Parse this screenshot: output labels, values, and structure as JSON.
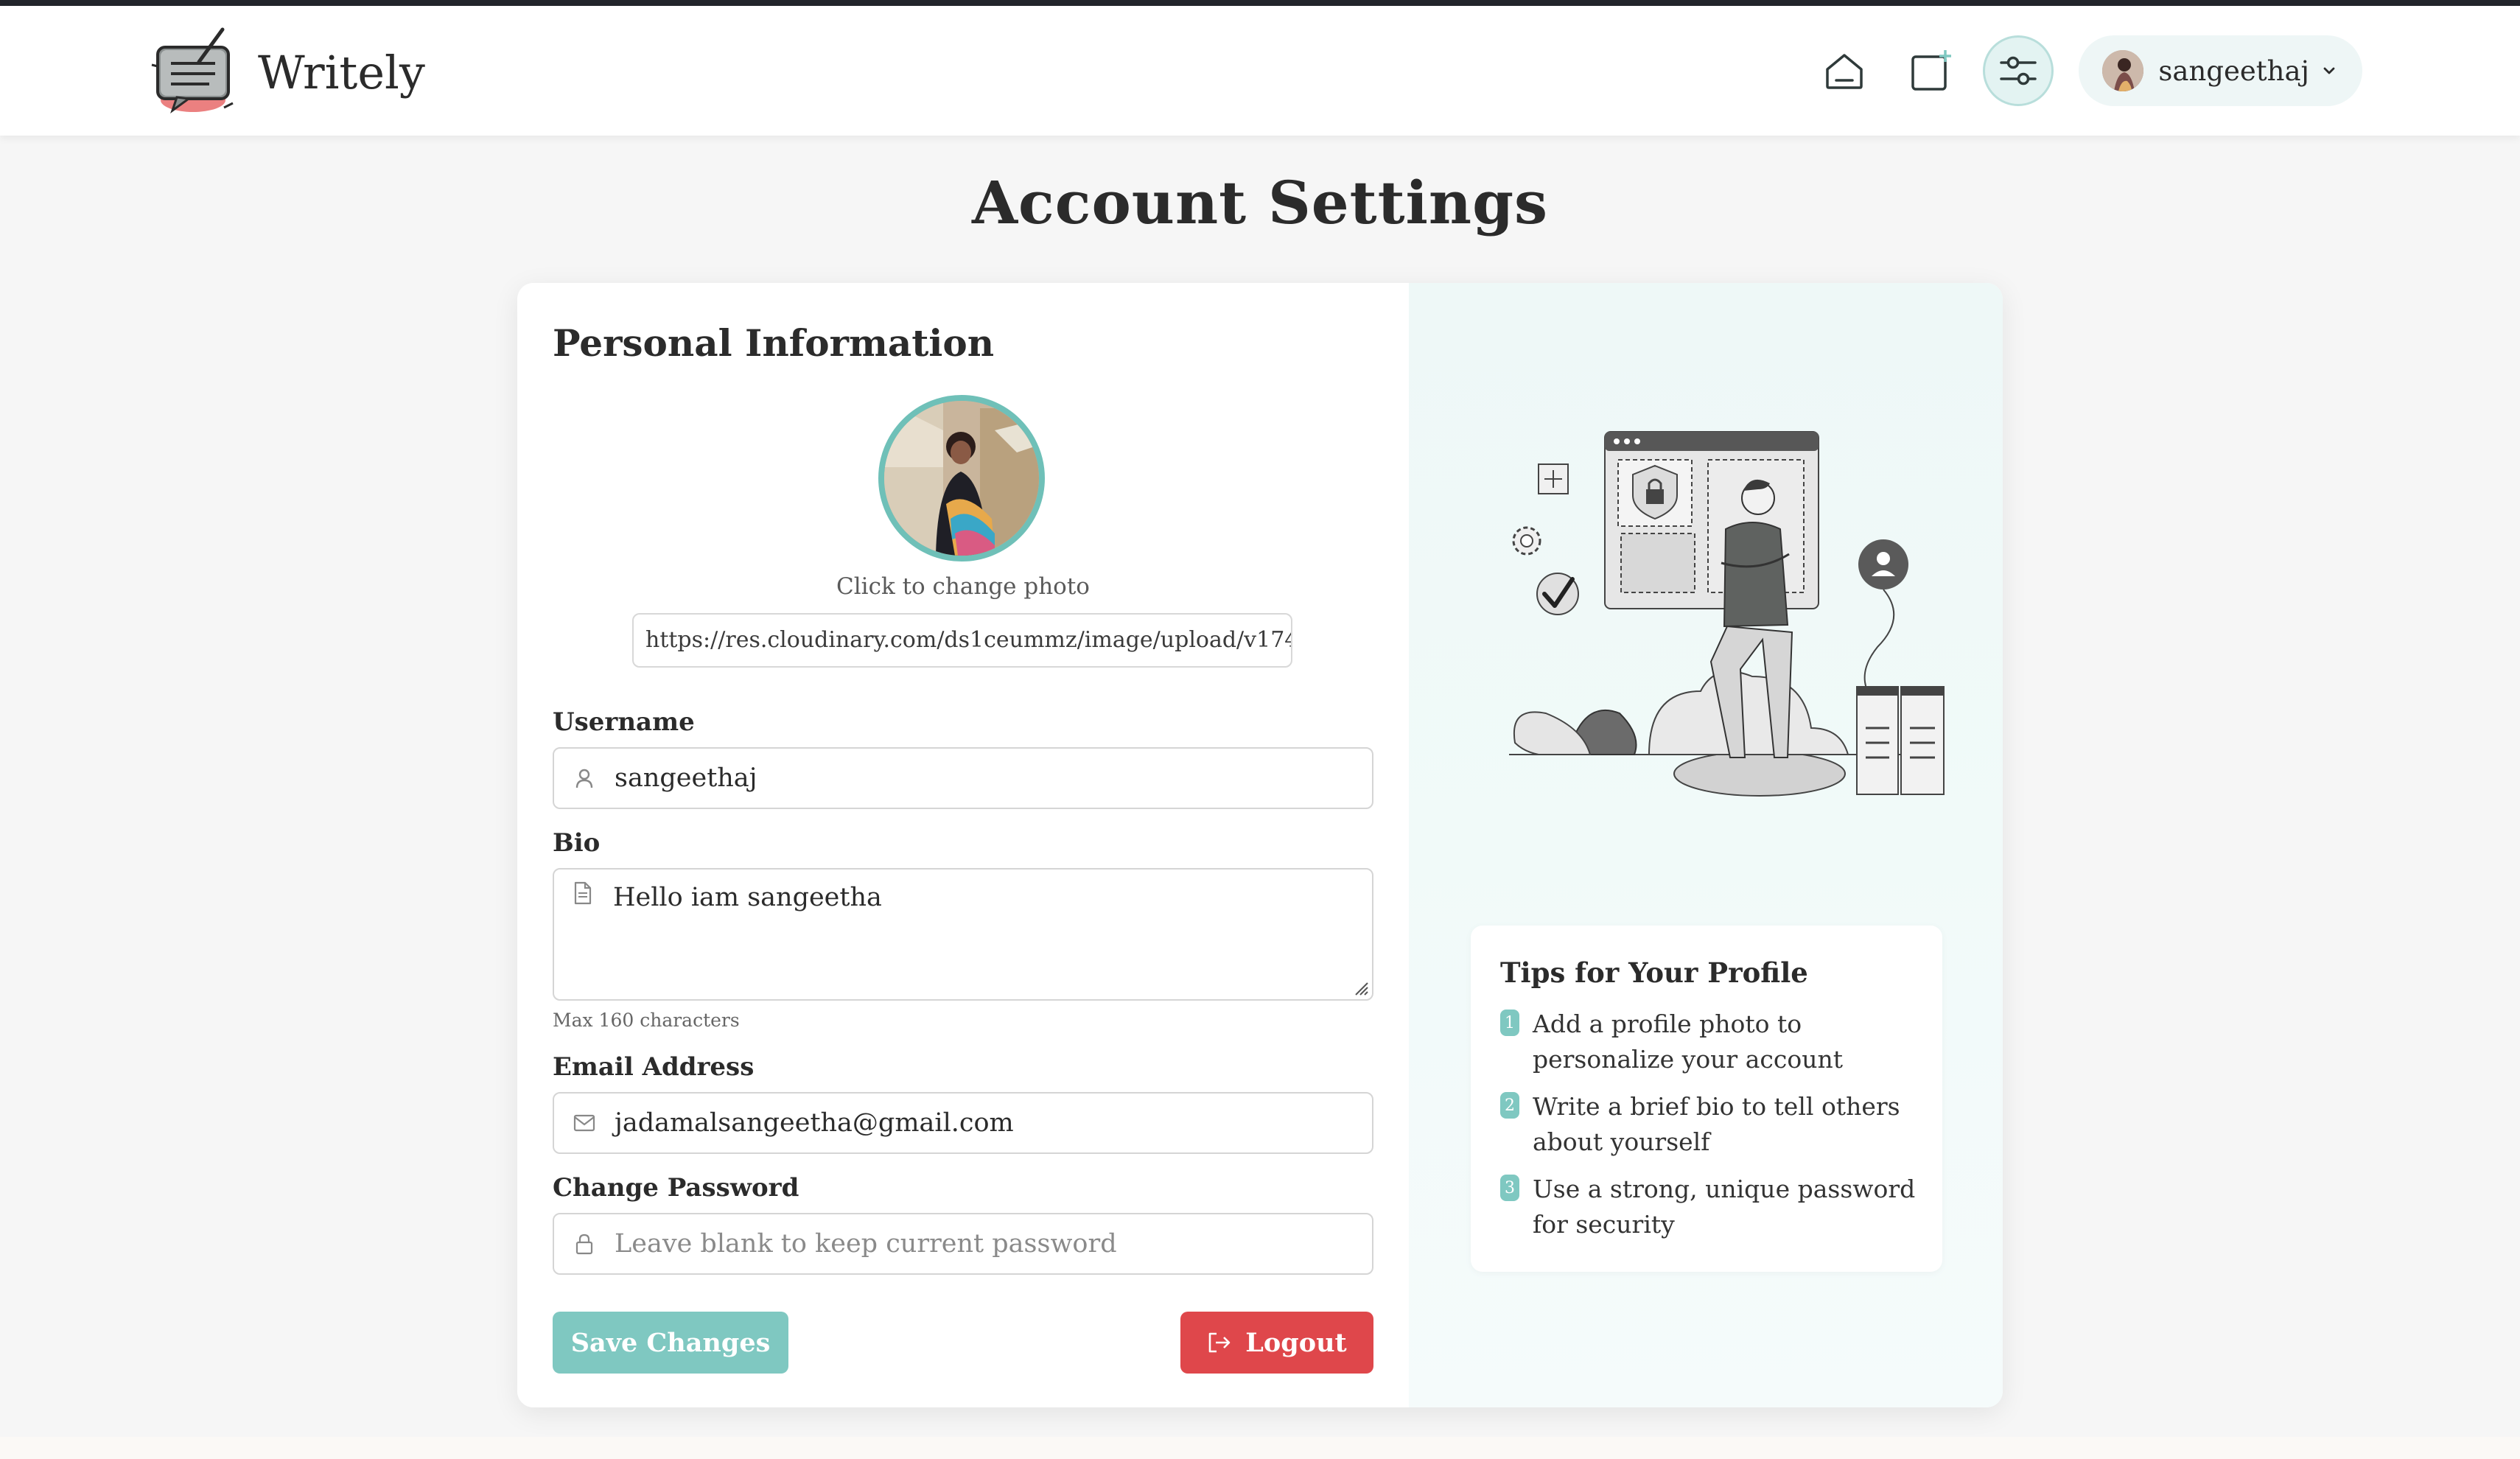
{
  "app": {
    "name": "Writely"
  },
  "nav": {
    "home_icon": "home-icon",
    "new_post_icon": "new-post-icon",
    "settings_icon": "settings-sliders-icon",
    "user": {
      "name": "sangeethaj"
    }
  },
  "page": {
    "title": "Account Settings"
  },
  "personal": {
    "title": "Personal Information",
    "change_photo": "Click to change photo",
    "photo_url": "https://res.cloudinary.com/ds1ceummz/image/upload/v174:",
    "username_label": "Username",
    "username_value": "sangeethaj",
    "bio_label": "Bio",
    "bio_value": "Hello iam sangeetha",
    "bio_hint": "Max 160 characters",
    "email_label": "Email Address",
    "email_value": "jadamalsangeetha@gmail.com",
    "password_label": "Change Password",
    "password_placeholder": "Leave blank to keep current password",
    "save_label": "Save Changes",
    "logout_label": "Logout"
  },
  "tips": {
    "title": "Tips for Your Profile",
    "items": [
      {
        "num": "1",
        "line1": "Add a profile photo to",
        "line2": "personalize your account"
      },
      {
        "num": "2",
        "line1": "Write a brief bio to tell others",
        "line2": "about yourself"
      },
      {
        "num": "3",
        "line1": "Use a strong, unique password",
        "line2": "for security"
      }
    ]
  },
  "colors": {
    "accent": "#7fc8c1",
    "danger": "#df474b",
    "text": "#2b2b2b"
  }
}
